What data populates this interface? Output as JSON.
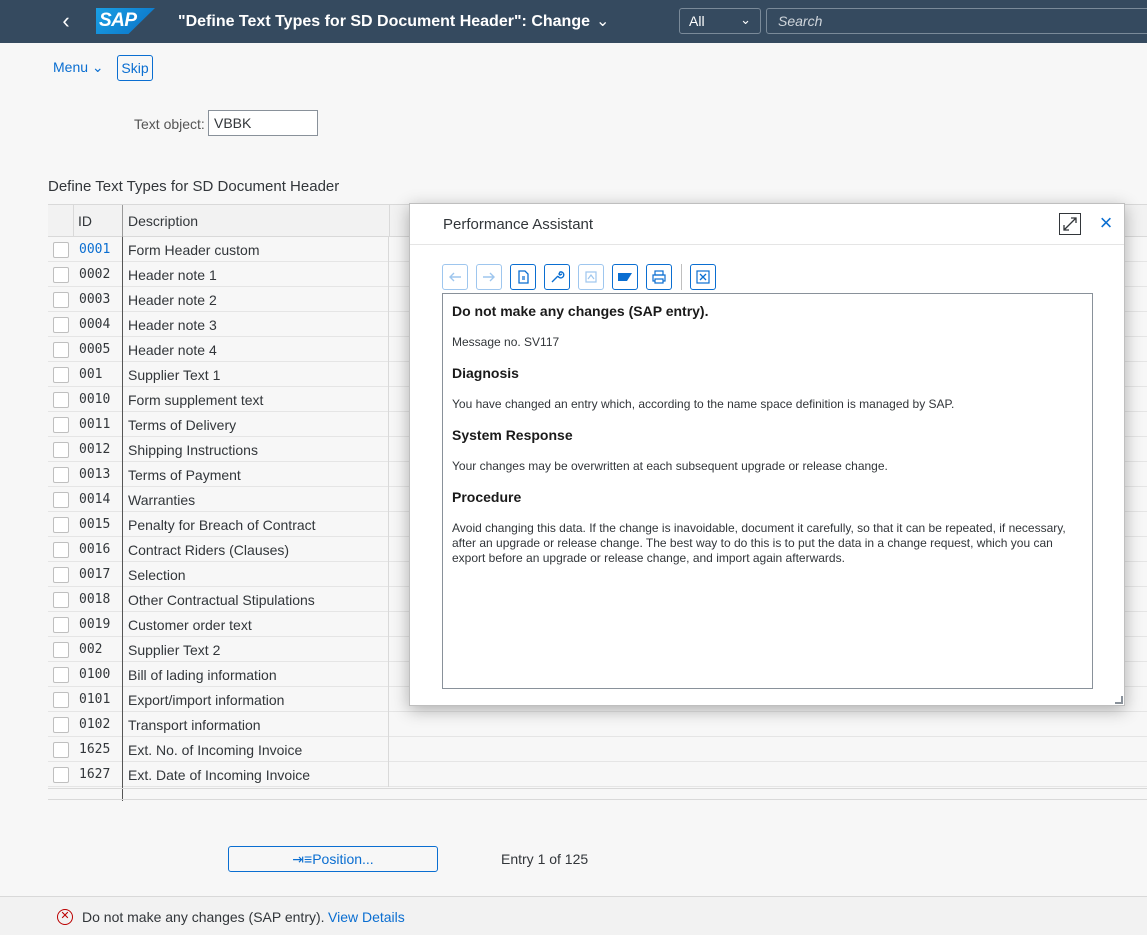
{
  "shell": {
    "title": "\"Define Text Types for SD Document Header\": Change",
    "scope": "All",
    "search_placeholder": "Search",
    "logo": "SAP"
  },
  "toolbar": {
    "menu_label": "Menu",
    "skip_label": "Skip"
  },
  "text_object": {
    "label": "Text object:",
    "value": "VBBK"
  },
  "table": {
    "title": "Define Text Types for SD Document Header",
    "columns": [
      "ID",
      "Description"
    ],
    "rows": [
      {
        "id": "0001",
        "desc": "Form Header custom"
      },
      {
        "id": "0002",
        "desc": "Header note 1"
      },
      {
        "id": "0003",
        "desc": "Header note 2"
      },
      {
        "id": "0004",
        "desc": "Header note 3"
      },
      {
        "id": "0005",
        "desc": "Header note 4"
      },
      {
        "id": "001",
        "desc": "Supplier Text 1"
      },
      {
        "id": "0010",
        "desc": "Form supplement text"
      },
      {
        "id": "0011",
        "desc": "Terms of Delivery"
      },
      {
        "id": "0012",
        "desc": "Shipping Instructions"
      },
      {
        "id": "0013",
        "desc": "Terms of Payment"
      },
      {
        "id": "0014",
        "desc": "Warranties"
      },
      {
        "id": "0015",
        "desc": "Penalty for Breach of Contract"
      },
      {
        "id": "0016",
        "desc": "Contract Riders (Clauses)"
      },
      {
        "id": "0017",
        "desc": "Selection"
      },
      {
        "id": "0018",
        "desc": "Other Contractual Stipulations"
      },
      {
        "id": "0019",
        "desc": "Customer order text"
      },
      {
        "id": "002",
        "desc": "Supplier Text 2"
      },
      {
        "id": "0100",
        "desc": "Bill of lading information"
      },
      {
        "id": "0101",
        "desc": "Export/import information"
      },
      {
        "id": "0102",
        "desc": "Transport information"
      },
      {
        "id": "1625",
        "desc": "Ext. No. of Incoming Invoice"
      },
      {
        "id": "1627",
        "desc": "Ext. Date of Incoming Invoice"
      }
    ]
  },
  "footer": {
    "position_label": "Position...",
    "entry_text": "Entry 1 of 125"
  },
  "status": {
    "message": "Do not make any changes (SAP entry).",
    "details_link": "View Details"
  },
  "dialog": {
    "title": "Performance Assistant",
    "heading": "Do not make any changes (SAP entry).",
    "message_no": "Message no. SV117",
    "sections": [
      {
        "title": "Diagnosis",
        "text": "You have changed an entry which, according to the name space definition is managed by SAP."
      },
      {
        "title": "System Response",
        "text": "Your changes may be overwritten at each subsequent upgrade or release change."
      },
      {
        "title": "Procedure",
        "text": "Avoid changing this data. If the change is inavoidable, document it carefully, so that it can be repeated, if necessary, after an upgrade or release change. The best way to do this is to put the data in a change request, which you can export before an upgrade or release change, and import again afterwards."
      }
    ]
  },
  "colors": {
    "shell": "#354a5f",
    "accent": "#0a6ed1",
    "error": "#bb0000"
  }
}
